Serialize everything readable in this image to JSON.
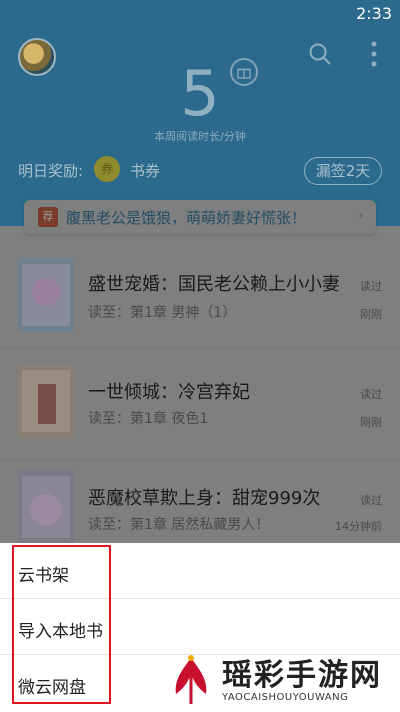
{
  "status_bar": {
    "time": "2:33"
  },
  "header": {
    "weekly_minutes": "5",
    "weekly_caption": "本周阅读时长/分钟",
    "reward_label": "明日奖励:",
    "coin_label": "券",
    "reward_item": "书券",
    "sign_button": "漏签2天",
    "icons": [
      "avatar",
      "search-icon",
      "more-icon",
      "gift-icon",
      "coin-icon"
    ]
  },
  "banner": {
    "badge": "荐",
    "text": "腹黑老公是饿狼，萌萌娇妻好慌张！",
    "arrow": "›"
  },
  "books": [
    {
      "title": "盛世宠婚：国民老公赖上小小妻",
      "progress": "读至：第1章 男神（1）",
      "read_label": "读过",
      "time": "刚刚"
    },
    {
      "title": "一世倾城：冷宫弃妃",
      "progress": "读至：第1章 夜色1",
      "read_label": "读过",
      "time": "刚刚"
    },
    {
      "title": "恶魔校草欺上身：甜宠999次",
      "progress": "读至：第1章 居然私藏男人！",
      "read_label": "读过",
      "time": "14分钟前"
    }
  ],
  "sheet": {
    "items": [
      "云书架",
      "导入本地书",
      "微云网盘"
    ]
  },
  "watermark": {
    "name": "瑶彩手游网",
    "url": "YAOCAISHOUYOUWANG"
  },
  "colors": {
    "highlight": "#e0141e",
    "banner_text": "#264d62"
  }
}
